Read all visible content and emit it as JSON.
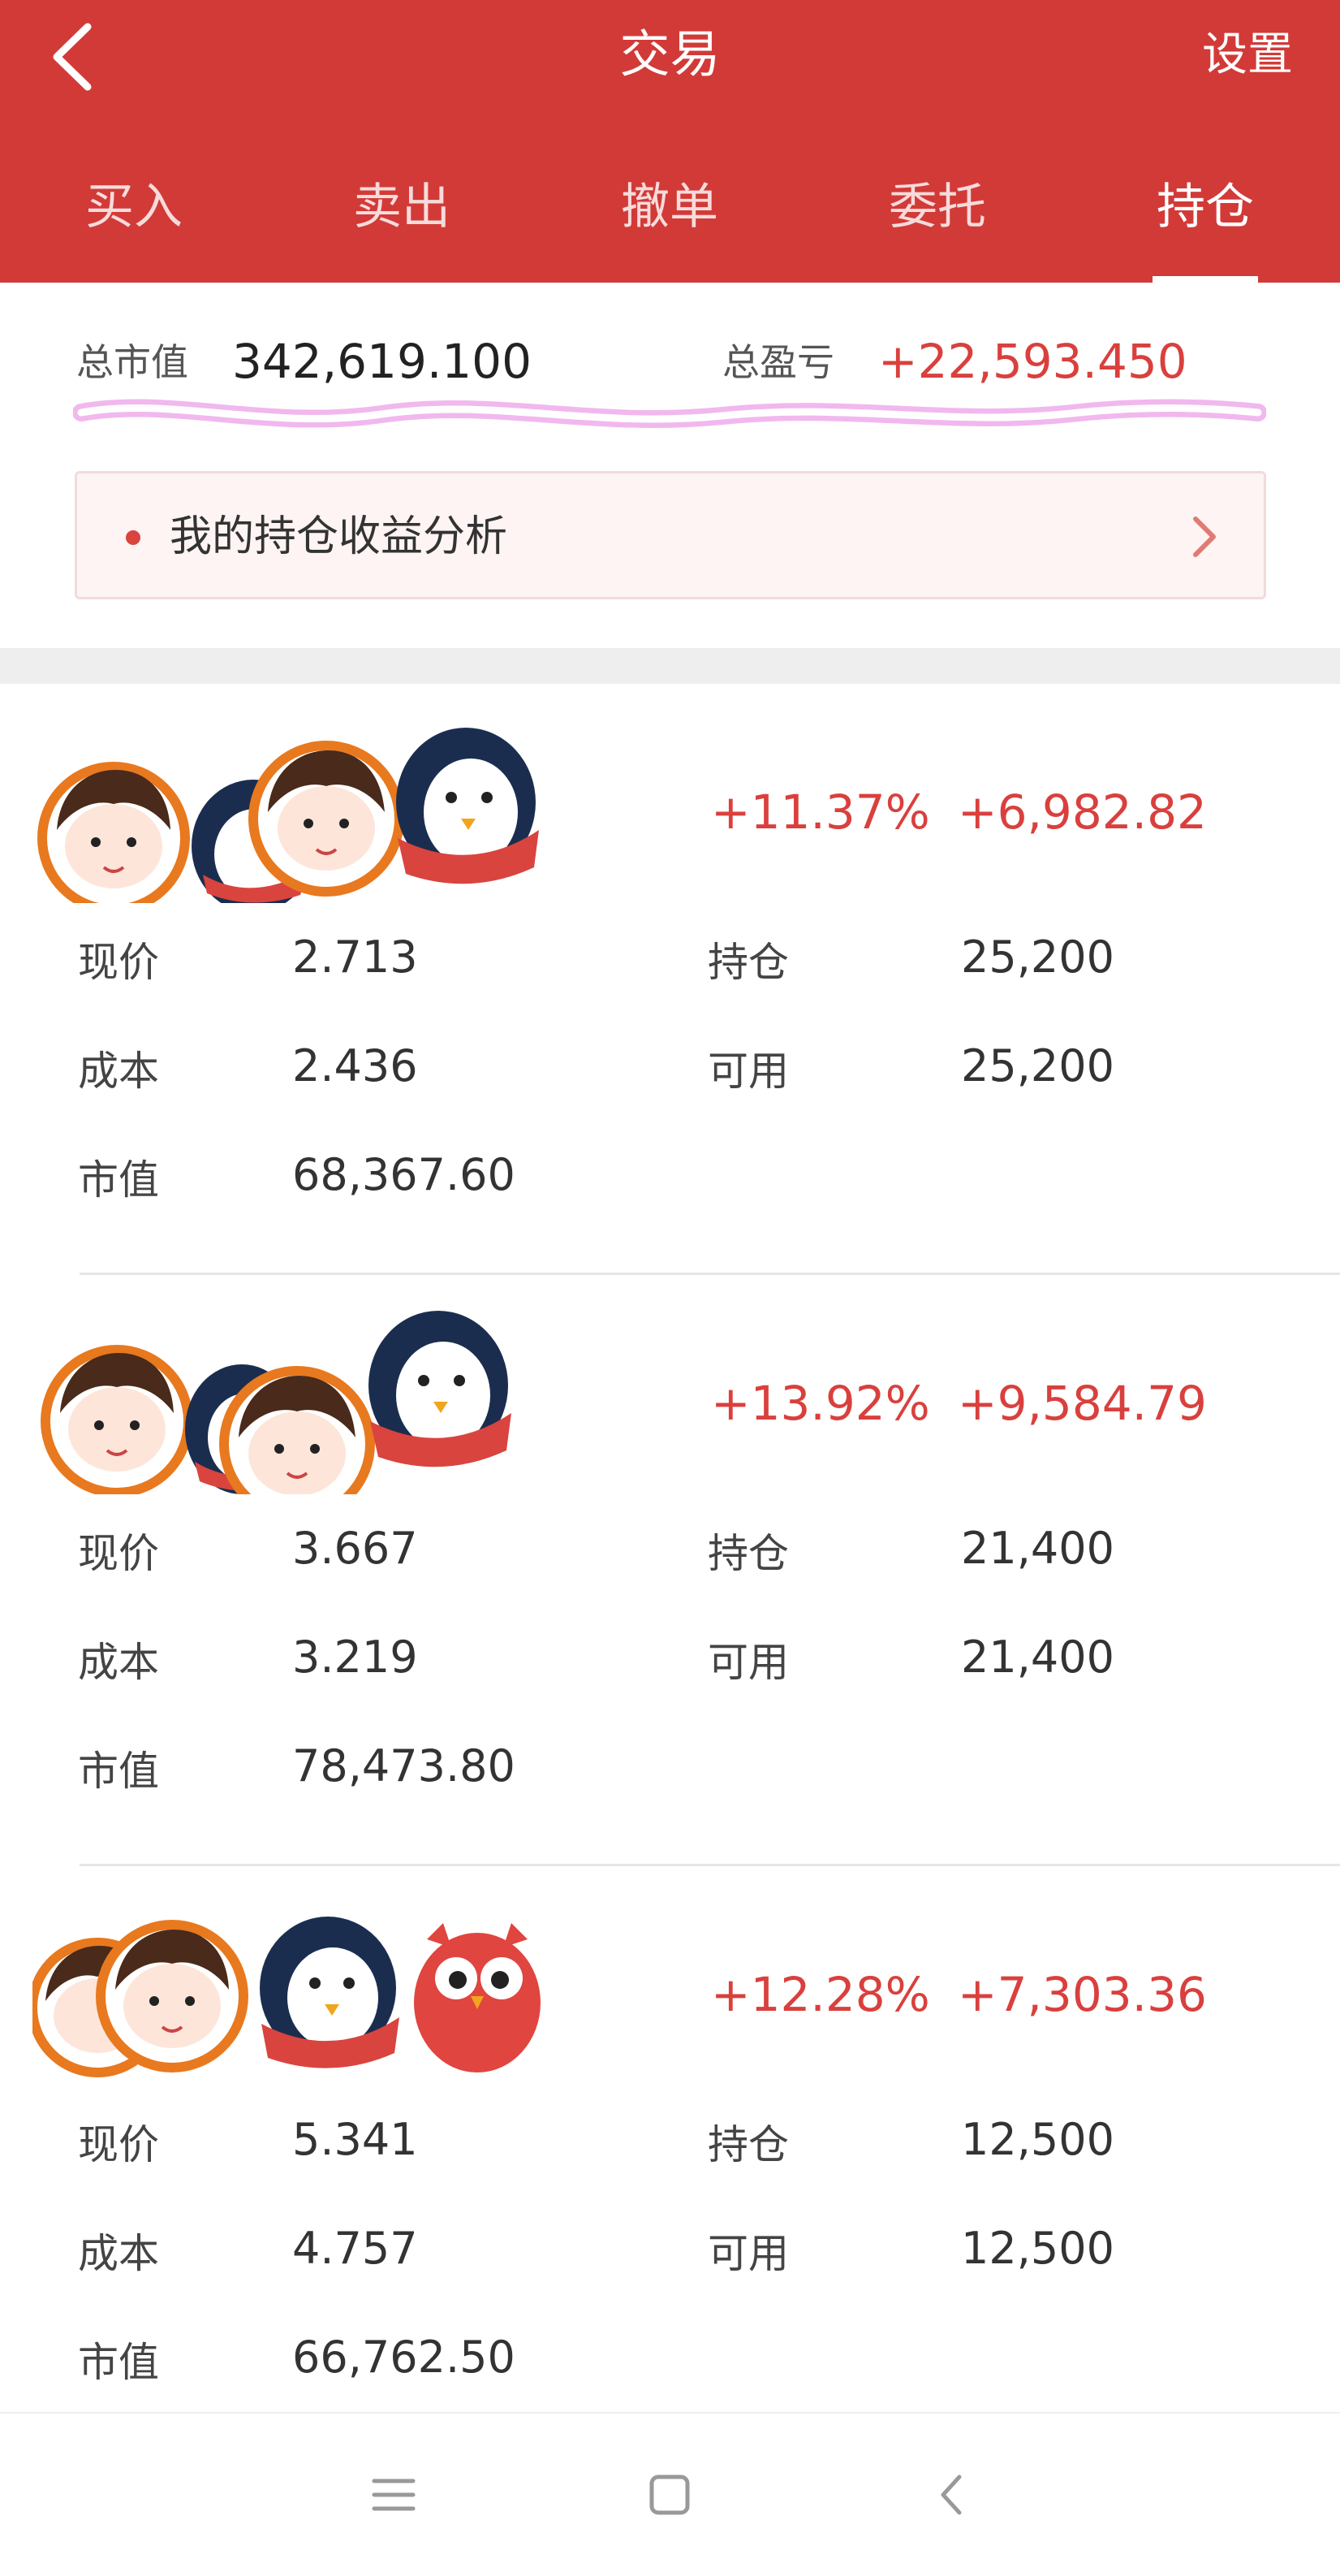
{
  "header": {
    "title": "交易",
    "settings_label": "设置",
    "color": "#d23a37"
  },
  "tabs": [
    {
      "label": "买入"
    },
    {
      "label": "卖出"
    },
    {
      "label": "撤单"
    },
    {
      "label": "委托"
    },
    {
      "label": "持仓",
      "active": true
    }
  ],
  "summary": {
    "total_value_label": "总市值",
    "total_value": "342,619.100",
    "total_pnl_label": "总盈亏",
    "total_pnl": "+22,593.450",
    "analysis_label": "我的持仓收益分析"
  },
  "labels": {
    "price": "现价",
    "cost": "成本",
    "market_value": "市值",
    "position": "持仓",
    "available": "可用"
  },
  "holdings": [
    {
      "avatar_icons": [
        "face-icon",
        "penguin-icon",
        "face-icon",
        "penguin-icon"
      ],
      "pnl_pct": "+11.37%",
      "pnl": "+6,982.82",
      "price": "2.713",
      "cost": "2.436",
      "market_value": "68,367.60",
      "position": "25,200",
      "available": "25,200"
    },
    {
      "avatar_icons": [
        "face-icon",
        "penguin-icon",
        "face-icon",
        "penguin-icon"
      ],
      "pnl_pct": "+13.92%",
      "pnl": "+9,584.79",
      "price": "3.667",
      "cost": "3.219",
      "market_value": "78,473.80",
      "position": "21,400",
      "available": "21,400"
    },
    {
      "avatar_icons": [
        "face-icon",
        "face-icon",
        "penguin-icon",
        "owl-icon"
      ],
      "pnl_pct": "+12.28%",
      "pnl": "+7,303.36",
      "price": "5.341",
      "cost": "4.757",
      "market_value": "66,762.50",
      "position": "12,500",
      "available": "12,500"
    }
  ],
  "nav": {
    "icons": [
      "menu-icon",
      "home-square-icon",
      "back-chevron-icon"
    ]
  }
}
